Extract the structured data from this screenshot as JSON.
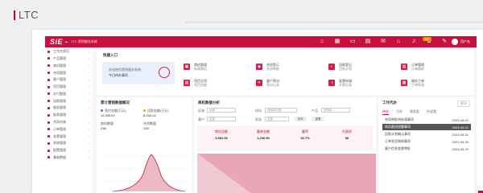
{
  "page": {
    "title": "LTC"
  },
  "app": {
    "logo": "SiE -",
    "system_name": "LTC 营销服务系统",
    "notification_count": "99+",
    "user_name": "用户名"
  },
  "topbar_icons": [
    "home-icon",
    "grid-icon",
    "monitor-icon",
    "chart-icon",
    "mail-icon",
    "house-icon",
    "bell-icon",
    "settings-icon",
    "message-icon"
  ],
  "sidebar": {
    "items": [
      {
        "label": "工作台首页"
      },
      {
        "label": "产品管理"
      },
      {
        "label": "商机管理"
      },
      {
        "label": "合同管理"
      },
      {
        "label": "客户管理"
      },
      {
        "label": "项目管理"
      },
      {
        "label": "交付管理"
      },
      {
        "label": "回款管理"
      },
      {
        "label": "服务管理"
      },
      {
        "label": "报表管理"
      },
      {
        "label": "合同台账"
      },
      {
        "label": "订单管理"
      },
      {
        "label": "发票管理"
      },
      {
        "label": "系统管理"
      },
      {
        "label": "配置管理"
      },
      {
        "label": "基础数据"
      }
    ]
  },
  "quick_entry": {
    "title": "快捷入口",
    "hero": {
      "line1": "欢迎使用营销服务系统",
      "line2": "今日待办事项"
    },
    "tiles": [
      {
        "label": "商机管理",
        "value": "新建商机"
      },
      {
        "label": "合同签订",
        "value": "合同审批"
      },
      {
        "label": "回款登记",
        "value": "回款计划"
      },
      {
        "label": "订单管理",
        "value": "订单跟踪"
      },
      {
        "label": "项目立项",
        "value": "项目进度"
      },
      {
        "label": "客户拜访",
        "value": "拜访记录"
      },
      {
        "label": "发票申请",
        "value": "开票记录"
      },
      {
        "label": "服务工单",
        "value": "工单处理"
      }
    ]
  },
  "sales_panel": {
    "title": "累计营销数据概况",
    "metrics": [
      {
        "label": "签约金额(万元)",
        "value": "12,345.67"
      },
      {
        "label": "回款金额(万元)",
        "value": "8,234.12"
      },
      {
        "label": "商机数量",
        "value": "236"
      },
      {
        "label": "合同数量",
        "value": "128"
      }
    ],
    "colors": {
      "dot1": "#3d7be0",
      "dot2": "#f0a020"
    }
  },
  "analysis_panel": {
    "title": "商机数据分析",
    "filters": [
      {
        "label": "区域",
        "value": "全部"
      },
      {
        "label": "时间",
        "value": "请选择日期"
      },
      {
        "label": "产品",
        "value": "请选择"
      },
      {
        "label": "客户",
        "value": "全部"
      },
      {
        "label": "状态",
        "value": "全部"
      }
    ],
    "buttons": {
      "search": "查询",
      "reset": "重置"
    },
    "kpis": [
      {
        "label": "商机总额",
        "value": "3,562.00"
      },
      {
        "label": "赢单金额",
        "value": "1,236.50"
      },
      {
        "label": "赢率",
        "value": "34.7%"
      },
      {
        "label": "在跟进",
        "value": "86"
      }
    ]
  },
  "todo_panel": {
    "title": "工作代办",
    "more": "更多",
    "tabs": [
      "待办",
      "已办",
      "我发起",
      "抄送我"
    ],
    "rows": [
      {
        "text": "合同审批待处理事项",
        "date": "2023-06-01"
      },
      {
        "text": "商机跟进提醒事项",
        "date": "2023-06-01"
      },
      {
        "text": "回款计划确认事项",
        "date": "2023-05-31"
      },
      {
        "text": "订单发货审核事项",
        "date": "2023-05-30"
      },
      {
        "text": "客户信息变更审批",
        "date": "2023-05-29"
      }
    ]
  }
}
